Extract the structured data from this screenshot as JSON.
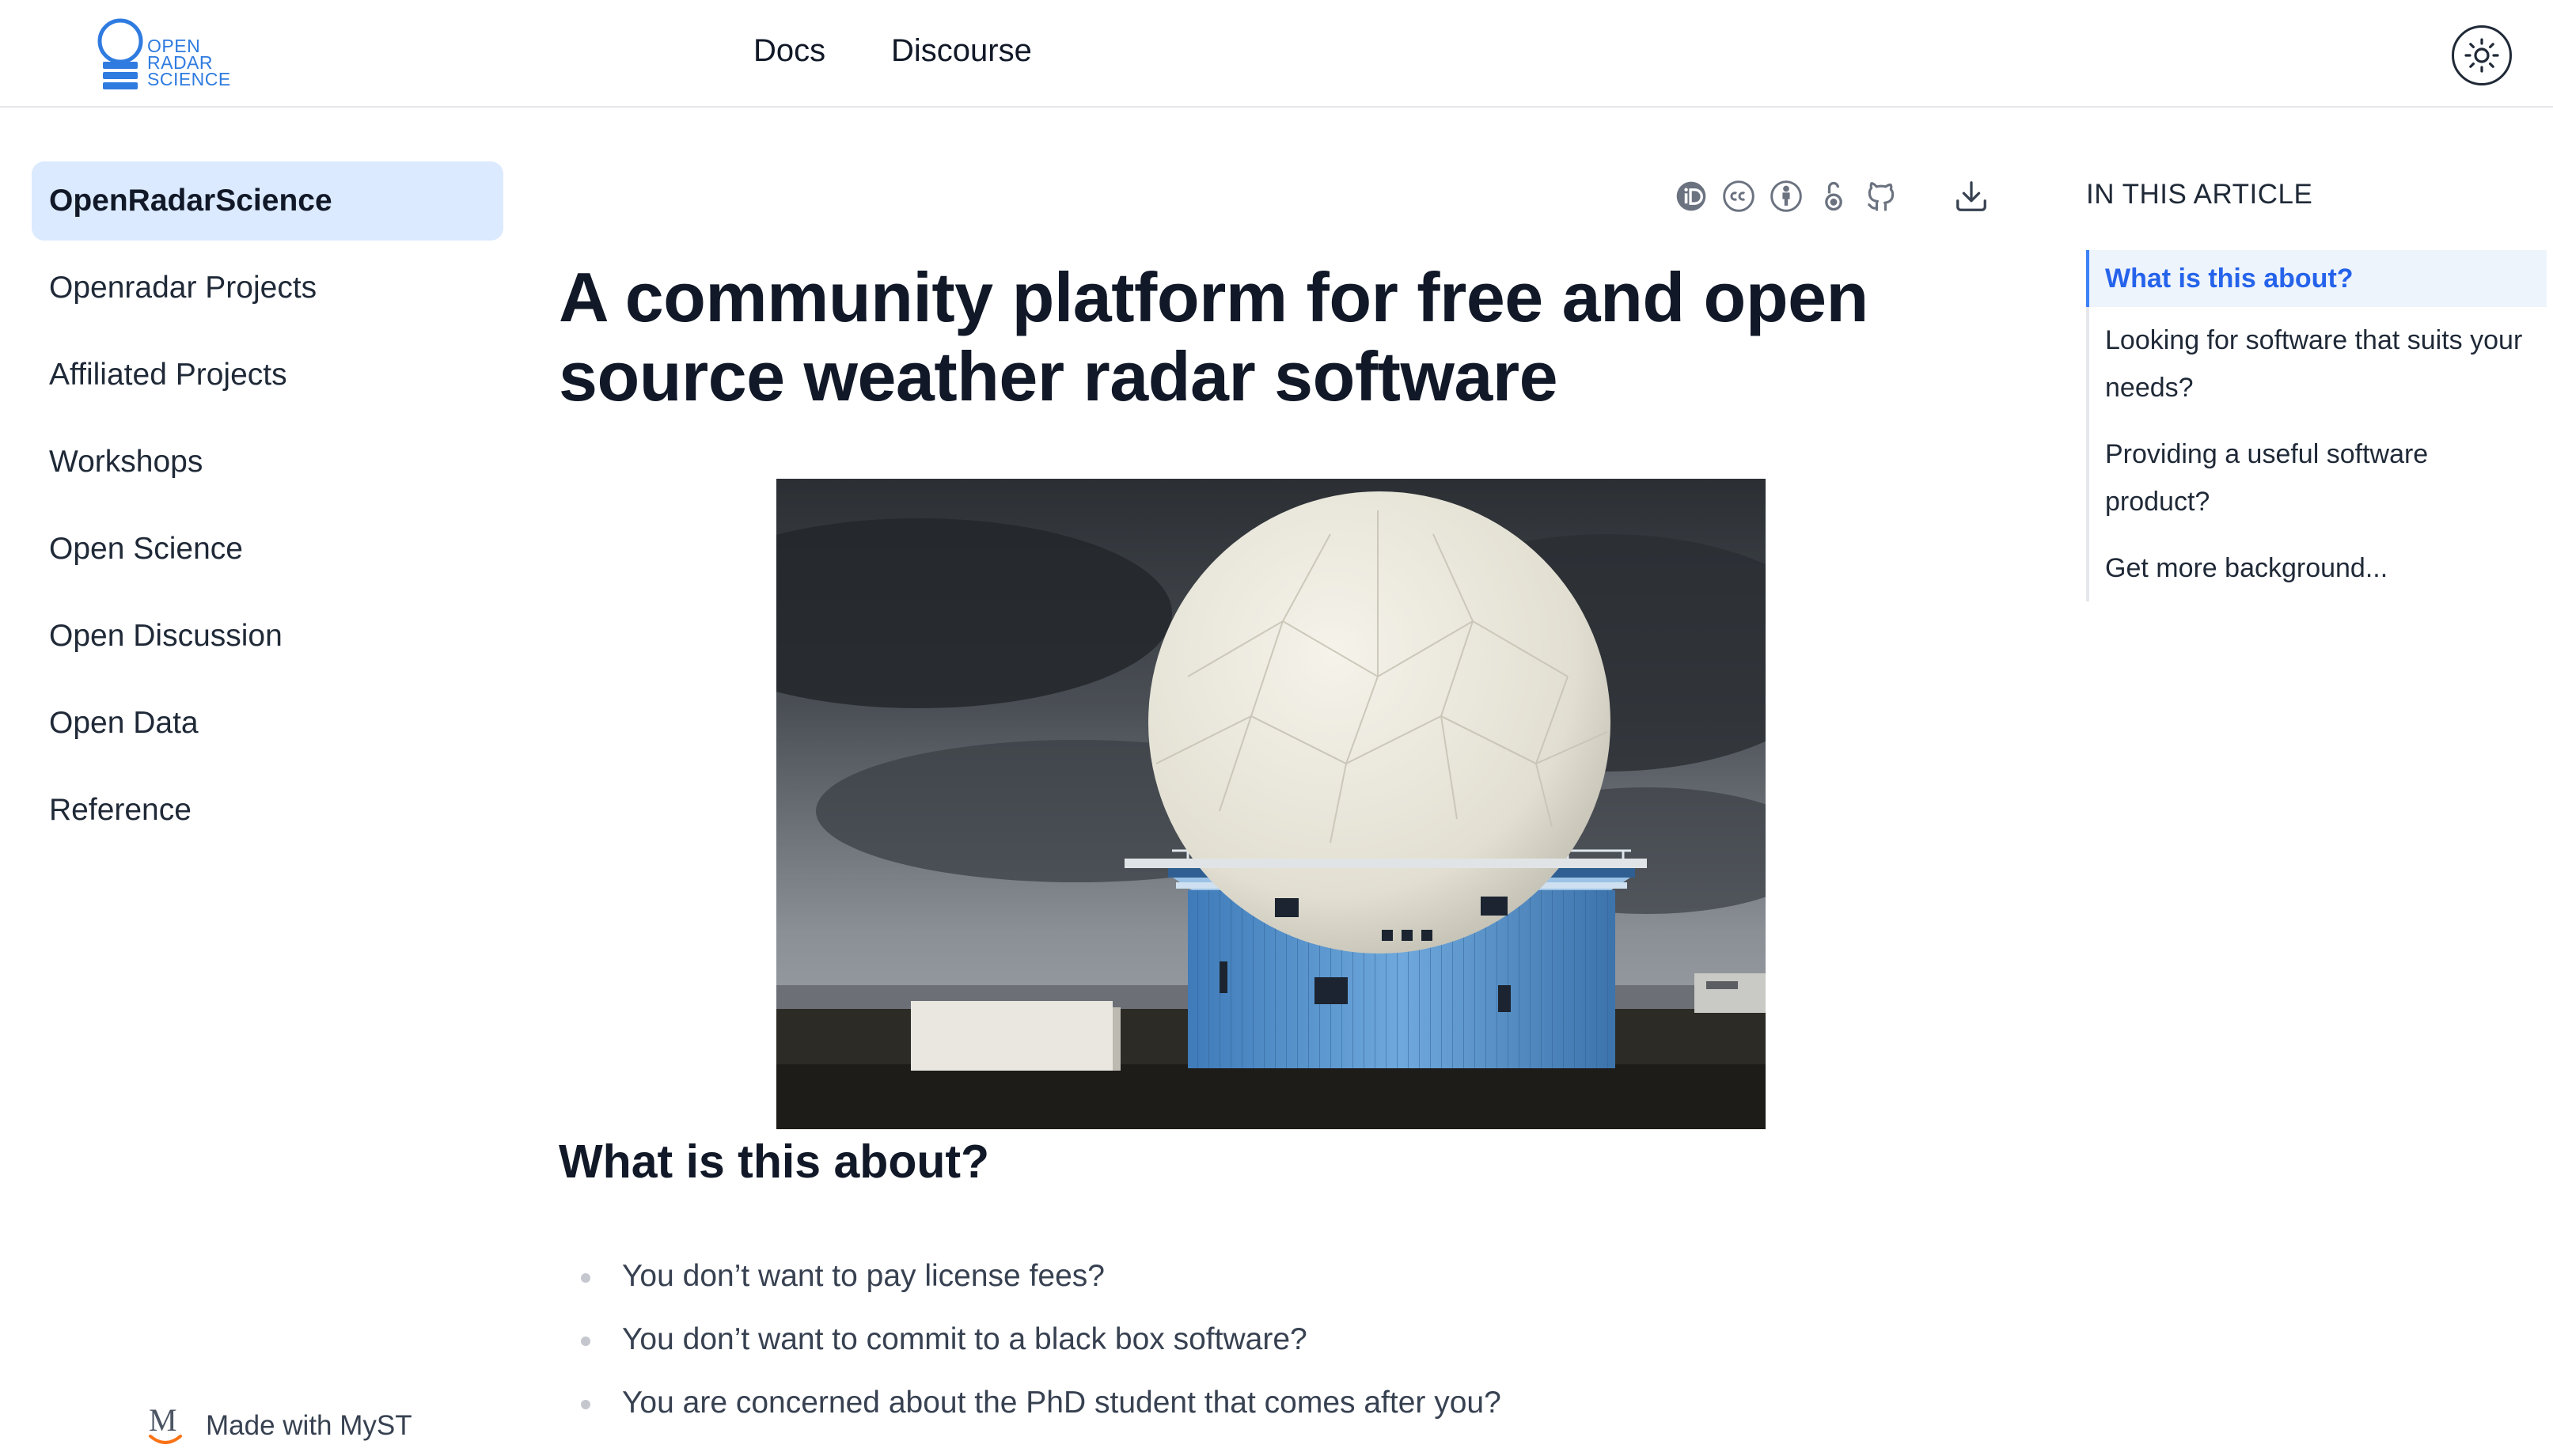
{
  "header": {
    "logo": {
      "line1": "OPEN",
      "line2": "RADAR",
      "line3": "SCIENCE"
    },
    "nav": [
      {
        "label": "Docs"
      },
      {
        "label": "Discourse"
      }
    ],
    "theme_toggle_icon": "sun-icon"
  },
  "sidebar": {
    "items": [
      {
        "label": "OpenRadarScience",
        "active": true
      },
      {
        "label": "Openradar Projects"
      },
      {
        "label": "Affiliated Projects"
      },
      {
        "label": "Workshops"
      },
      {
        "label": "Open Science"
      },
      {
        "label": "Open Discussion"
      },
      {
        "label": "Open Data"
      },
      {
        "label": "Reference"
      }
    ],
    "footer": {
      "logo_letter": "M",
      "label": "Made with MyST"
    }
  },
  "article": {
    "toolbar_icons": [
      "orcid-icon",
      "cc-icon",
      "cc-by-icon",
      "open-access-icon",
      "github-icon",
      "download-icon"
    ],
    "title": "A community platform for free and open source weather radar software",
    "hero_image": "weather-radar-dome-photo",
    "section_heading": "What is this about?",
    "bullets": [
      "You don’t want to pay license fees?",
      "You don’t want to commit to a black box software?",
      "You are concerned about the PhD student that comes after you?"
    ]
  },
  "toc": {
    "heading": "IN THIS ARTICLE",
    "items": [
      {
        "label": "What is this about?",
        "active": true
      },
      {
        "label": "Looking for software that suits your needs?"
      },
      {
        "label": "Providing a useful software product?"
      },
      {
        "label": "Get more background..."
      }
    ]
  },
  "colors": {
    "accent": "#2563eb",
    "logo": "#2f7be0",
    "active_bg": "#dbeafe"
  }
}
